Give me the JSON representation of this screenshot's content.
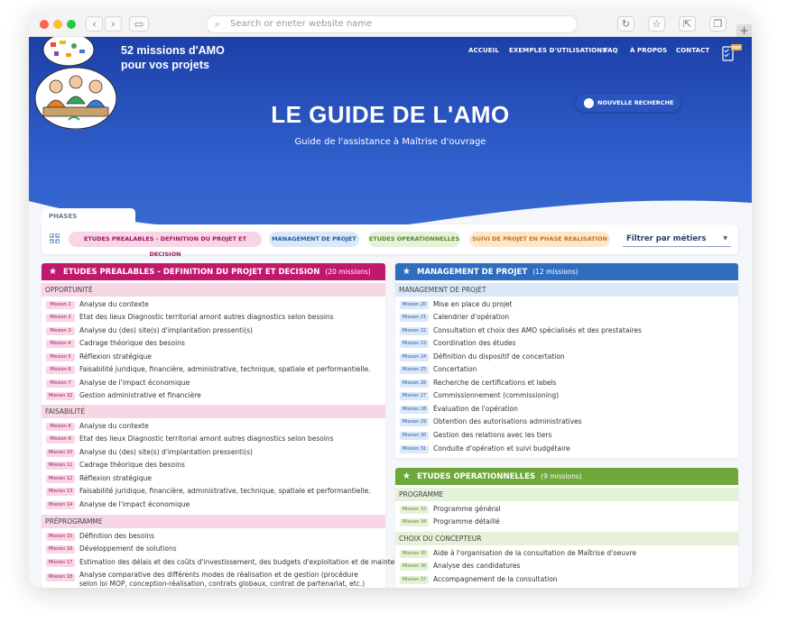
{
  "browser": {
    "url_placeholder": "Search or eneter website name"
  },
  "site": {
    "brand_line1": "52 missions d'AMO",
    "brand_line2": "pour vos projets",
    "nav": [
      "ACCUEIL",
      "EXEMPLES D'UTILISATIONS",
      "FAQ",
      "À PROPOS",
      "CONTACT"
    ],
    "pdf_badge": "PDF",
    "cta": "NOUVELLE RECHERCHE",
    "title": "LE GUIDE DE L'AMO",
    "subtitle": "Guide de l'assistance à Maîtrise d'ouvrage"
  },
  "filters": {
    "tab": "PHASES",
    "pills": [
      "ETUDES PREALABLES - DEFINITION DU PROJET ET DECISION",
      "MANAGEMENT DE PROJET",
      "ETUDES OPERATIONNELLES",
      "SUIVI DE PROJET EN PHASE REALISATION"
    ],
    "select_label": "Filtrer par métiers"
  },
  "colors": {
    "etudes_prealables": "#c2186b",
    "etudes_prealables_light": "#f7d6e6",
    "management": "#2f6dbf",
    "management_light": "#dbe8f7",
    "operationnelles": "#6fa83a",
    "operationnelles_light": "#e6f1d9",
    "suivi_light": "#fbe7cc"
  },
  "panels": {
    "left": {
      "title": "ETUDES PREALABLES - DEFINITION DU PROJET ET DECISION",
      "count": "(20 missions)",
      "sections": [
        {
          "name": "OPPORTUNITÉ",
          "rows": [
            {
              "tag": "Mission 1",
              "text": "Analyse du contexte"
            },
            {
              "tag": "Mission 2",
              "text": "Etat des lieux Diagnostic territorial amont autres diagnostics selon besoins"
            },
            {
              "tag": "Mission 3",
              "text": "Analyse du (des) site(s) d'implantation pressenti(s)"
            },
            {
              "tag": "Mission 4",
              "text": "Cadrage théorique des besoins"
            },
            {
              "tag": "Mission 5",
              "text": "Réflexion stratégique"
            },
            {
              "tag": "Mission 6",
              "text": "Faisabilité juridique, financière, administrative, technique, spatiale et performantielle."
            },
            {
              "tag": "Mission 7",
              "text": "Analyse de l'impact économique"
            },
            {
              "tag": "Mission 32",
              "text": "Gestion administrative et financière"
            }
          ]
        },
        {
          "name": "FAISABILITÉ",
          "rows": [
            {
              "tag": "Mission 8",
              "text": "Analyse du contexte"
            },
            {
              "tag": "Mission 9",
              "text": "Etat des lieux Diagnostic territorial amont autres diagnostics selon besoins"
            },
            {
              "tag": "Mission 10",
              "text": "Analyse du (des) site(s) d'implantation pressenti(s)"
            },
            {
              "tag": "Mission 11",
              "text": "Cadrage théorique des besoins"
            },
            {
              "tag": "Mission 12",
              "text": "Réflexion stratégique"
            },
            {
              "tag": "Mission 13",
              "text": "Faisabilité juridique, financière, administrative, technique, spatiale et performantielle."
            },
            {
              "tag": "Mission 14",
              "text": "Analyse de l'impact économique"
            }
          ]
        },
        {
          "name": "PRÉPROGRAMME",
          "rows": [
            {
              "tag": "Mission 15",
              "text": "Définition des besoins"
            },
            {
              "tag": "Mission 16",
              "text": "Développement de solutions"
            },
            {
              "tag": "Mission 17",
              "text": "Estimation des délais et des coûts d'investissement, des budgets d'exploitation et de maintenance"
            },
            {
              "tag": "Mission 18",
              "text": "Analyse comparative des différents modes de réalisation et de gestion (procédure selon loi MOP, conception-réalisation, contrats globaux, contrat de partenariat, etc.)"
            }
          ]
        }
      ]
    },
    "management": {
      "title": "MANAGEMENT DE PROJET",
      "count": "(12 missions)",
      "sections": [
        {
          "name": "MANAGEMENT DE PROJET",
          "rows": [
            {
              "tag": "Mission 20",
              "text": "Mise en place du projet"
            },
            {
              "tag": "Mission 21",
              "text": "Calendrier d'opération"
            },
            {
              "tag": "Mission 22",
              "text": "Consultation et choix des AMO spécialisés et des prestataires"
            },
            {
              "tag": "Mission 23",
              "text": "Coordination des études"
            },
            {
              "tag": "Mission 24",
              "text": "Définition du dispositif de concertation"
            },
            {
              "tag": "Mission 25",
              "text": "Concertation"
            },
            {
              "tag": "Mission 26",
              "text": "Recherche de certifications et labels"
            },
            {
              "tag": "Mission 27",
              "text": "Commissionnement (commissioning)"
            },
            {
              "tag": "Mission 28",
              "text": "Évaluation de l'opération"
            },
            {
              "tag": "Mission 29",
              "text": "Obtention des autorisations administratives"
            },
            {
              "tag": "Mission 30",
              "text": "Gestion des relations avec les tiers"
            },
            {
              "tag": "Mission 31",
              "text": "Conduite d'opération et suivi budgétaire"
            }
          ]
        }
      ]
    },
    "operationnelles": {
      "title": "ETUDES OPERATIONNELLES",
      "count": "(9 missions)",
      "sections": [
        {
          "name": "PROGRAMME",
          "rows": [
            {
              "tag": "Mission 33",
              "text": "Programme général"
            },
            {
              "tag": "Mission 34",
              "text": "Programme détaillé"
            }
          ]
        },
        {
          "name": "CHOIX DU CONCEPTEUR",
          "rows": [
            {
              "tag": "Mission 35",
              "text": "Aide à l'organisation de la consultation de Maîtrise d'oeuvre"
            },
            {
              "tag": "Mission 36",
              "text": "Analyse des candidatures"
            },
            {
              "tag": "Mission 37",
              "text": "Accompagnement de la consultation"
            }
          ]
        }
      ]
    }
  }
}
